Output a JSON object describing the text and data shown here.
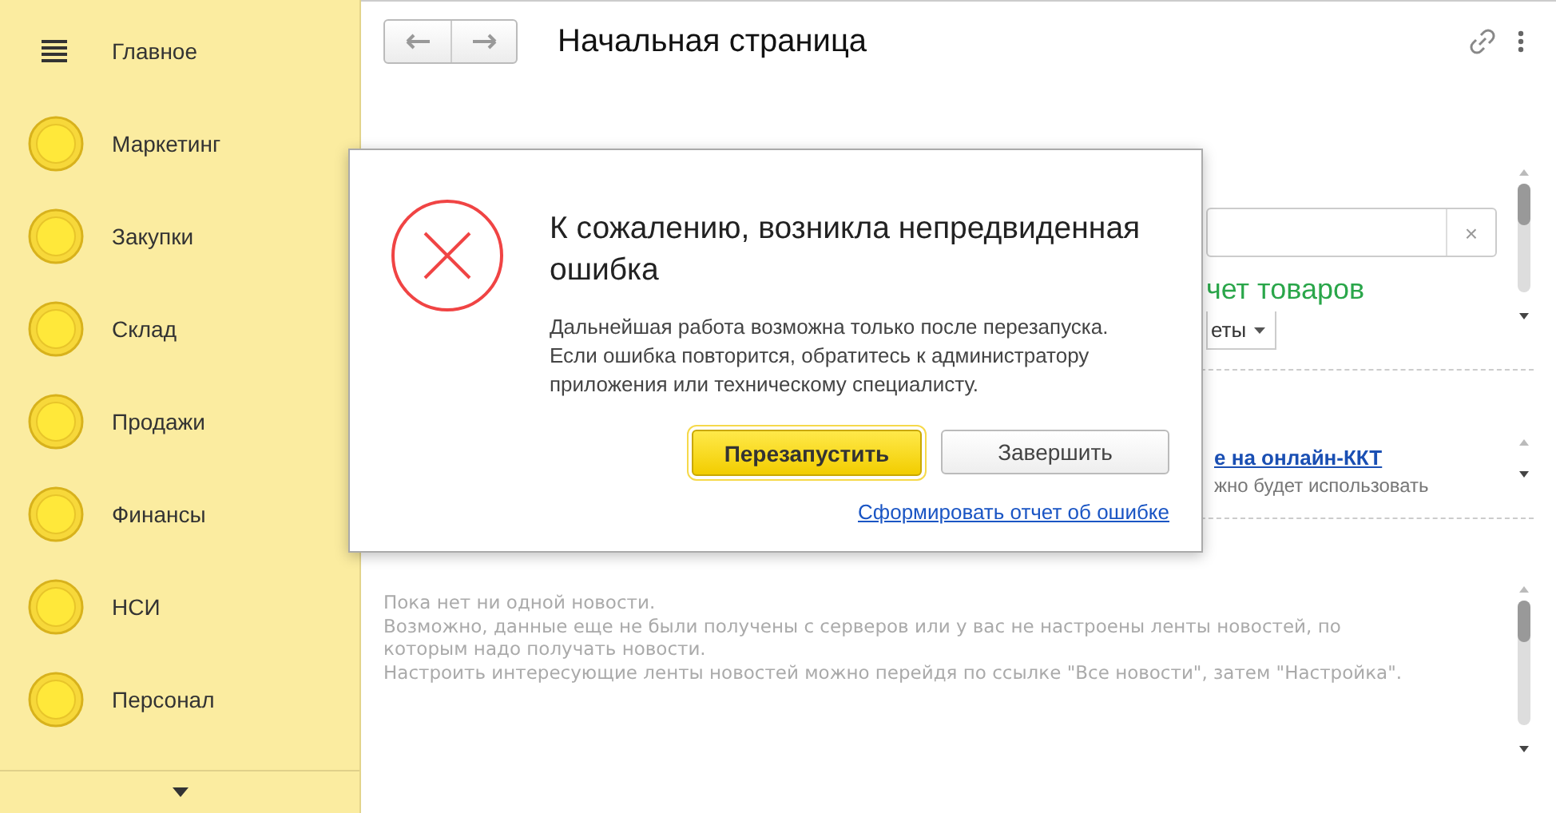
{
  "sidebar": {
    "items": [
      {
        "label": "Главное",
        "kind": "menu"
      },
      {
        "label": "Маркетинг",
        "kind": "section"
      },
      {
        "label": "Закупки",
        "kind": "section"
      },
      {
        "label": "Склад",
        "kind": "section"
      },
      {
        "label": "Продажи",
        "kind": "section"
      },
      {
        "label": "Финансы",
        "kind": "section"
      },
      {
        "label": "НСИ",
        "kind": "section"
      },
      {
        "label": "Персонал",
        "kind": "section"
      }
    ]
  },
  "header": {
    "title": "Начальная страница"
  },
  "background": {
    "clear": "×",
    "section_title": "чет товаров",
    "dropdown": "еты",
    "link": "е на онлайн-ККТ",
    "note": "жно будет использовать",
    "news_text": "Пока нет ни одной новости.\nВозможно, данные еще не были получены с серверов или у вас не настроены ленты новостей, по\nкоторым надо получать новости.\nНастроить интересующие ленты новостей можно перейдя по ссылке \"Все новости\", затем \"Настройка\"."
  },
  "dialog": {
    "title": "К сожалению, возникла непредвиденная ошибка",
    "message": "Дальнейшая работа возможна только после перезапуска.\nЕсли ошибка повторится, обратитесь к администратору\nприложения или техническому специалисту.",
    "buttons": [
      {
        "label": "Перезапустить",
        "kind": "primary"
      },
      {
        "label": "Завершить",
        "kind": "secondary"
      }
    ],
    "link": "Сформировать отчет об ошибке"
  }
}
